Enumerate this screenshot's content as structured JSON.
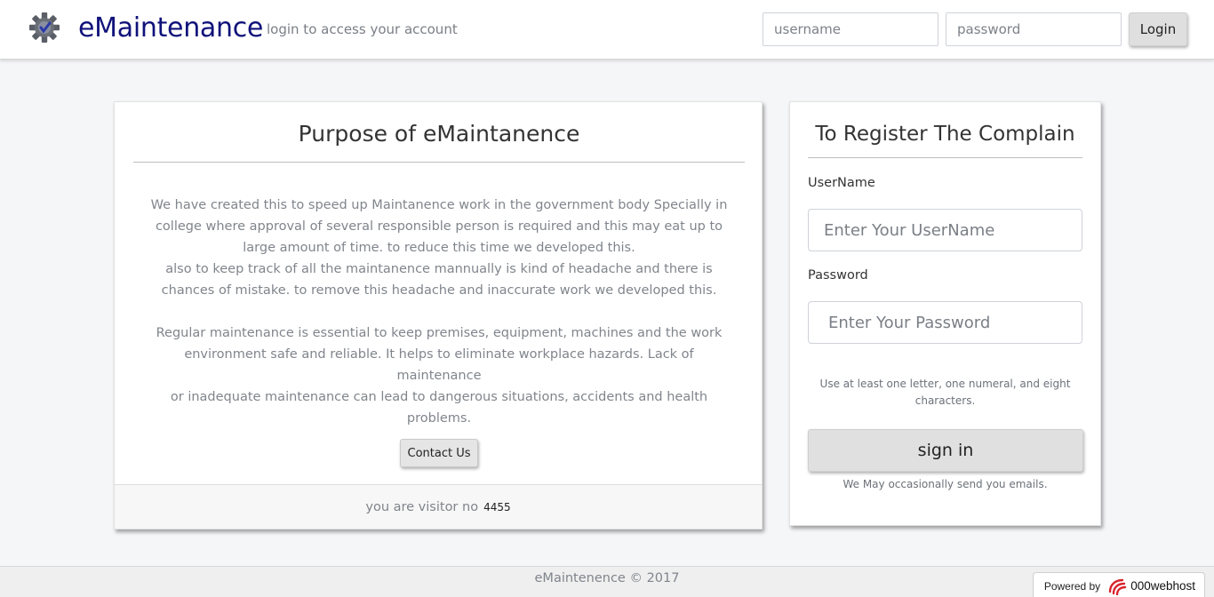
{
  "header": {
    "brand": "eMaintenance",
    "tagline": "login to access your account",
    "username_placeholder": "username",
    "password_placeholder": "password",
    "login_label": "Login"
  },
  "about": {
    "title": "Purpose of eMaintanence",
    "paragraph1_lines": [
      "We have created this to speed up Maintanence work in the government body Specially in",
      "college where approval of several responsible person is required and this may eat up to",
      "large amount of time. to reduce this time we developed this.",
      "also to keep track of all the maintanence mannually is kind of headache and there is",
      "chances of mistake. to remove this headache and inaccurate work we developed this."
    ],
    "paragraph2_lines": [
      "Regular maintenance is essential to keep premises, equipment, machines and the work",
      "environment safe and reliable. It helps to eliminate workplace hazards. Lack of maintenance",
      "or inadequate maintenance can lead to dangerous situations, accidents and health",
      "problems."
    ],
    "contact_label": "Contact Us",
    "visitor_label": "you are visitor no",
    "visitor_count": "4455"
  },
  "register": {
    "title": "To Register The Complain",
    "username_label": "UserName",
    "username_placeholder": "Enter Your UserName",
    "password_label": "Password",
    "password_placeholder": "Enter Your Password",
    "hint_lines": [
      "Use at least one letter, one numeral, and eight",
      "characters."
    ],
    "signin_label": "sign in",
    "email_note": "We May occasionally send you emails."
  },
  "footer": {
    "copyright": "eMaintenence © 2017",
    "powered_label": "Powered by",
    "host_name": "000webhost"
  },
  "colors": {
    "brand": "#10127a",
    "muted_text": "#80858c",
    "button_bg": "#e0e0e0",
    "page_bg": "#f5f6f8"
  },
  "icons": {
    "logo": "gear-check-icon",
    "host": "webhost-swirl-icon"
  }
}
